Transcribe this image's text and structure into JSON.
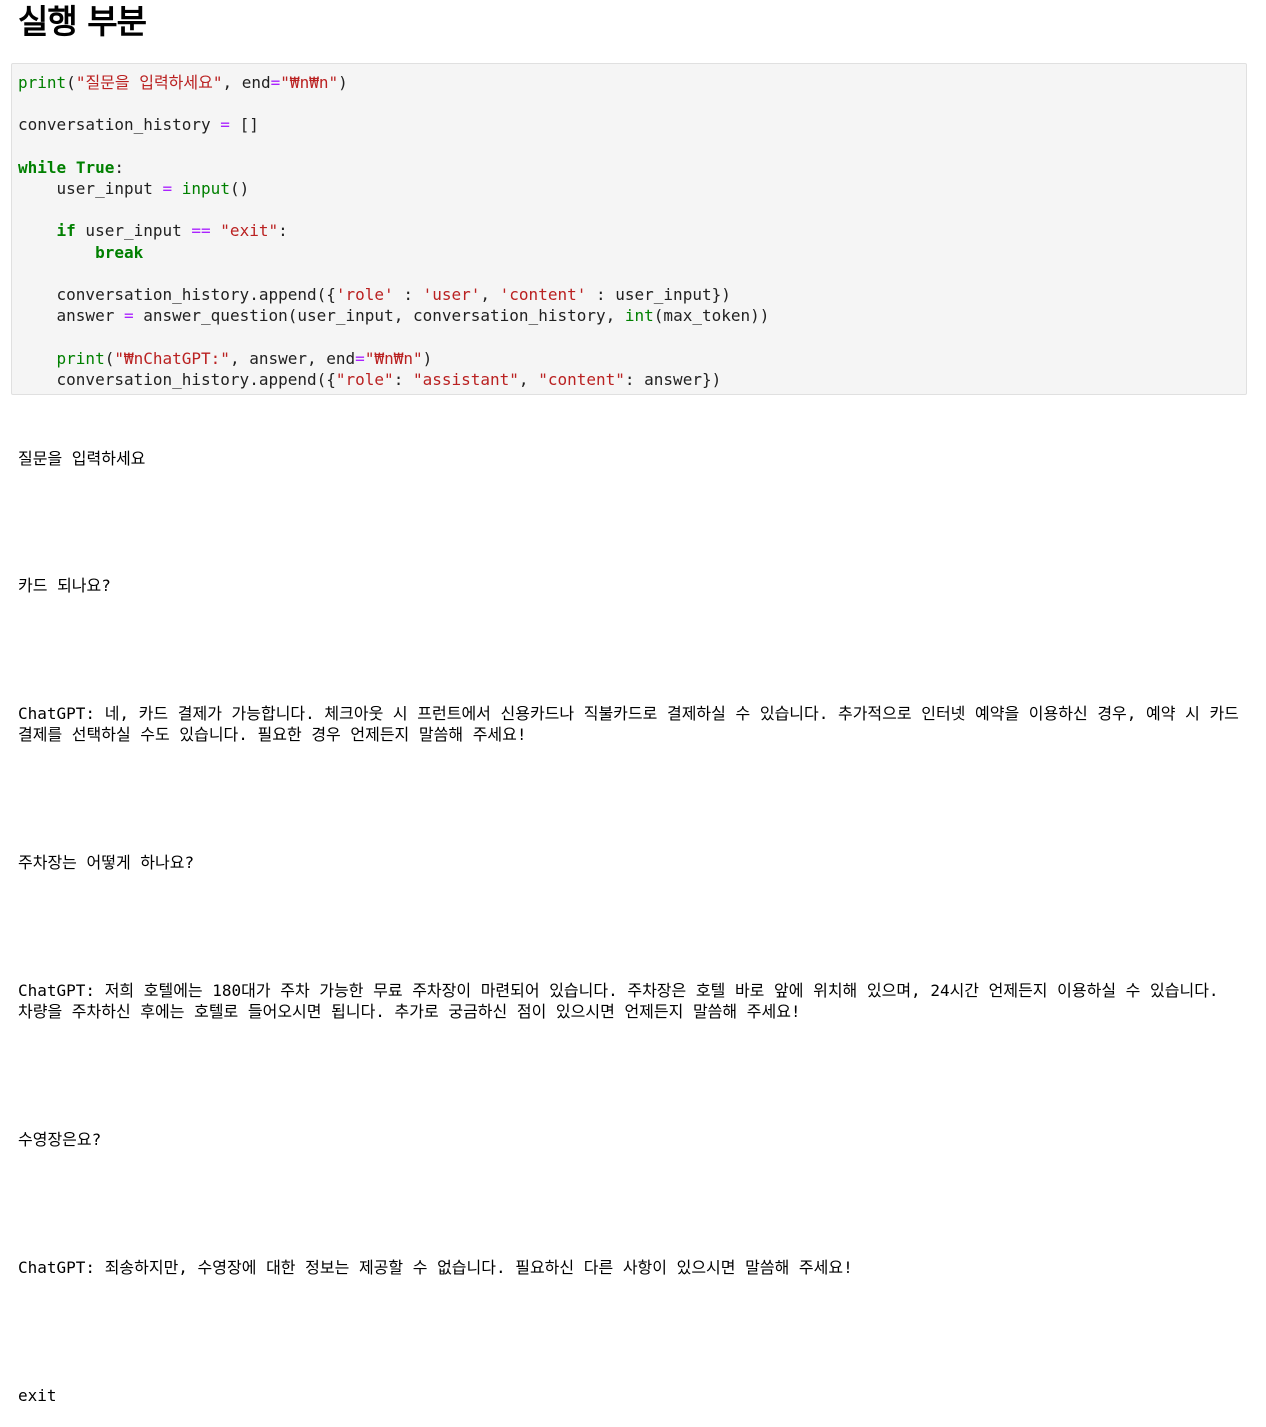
{
  "heading": "실행 부분",
  "code_lines": [
    [
      {
        "t": "bi",
        "v": "print"
      },
      {
        "t": "p",
        "v": "("
      },
      {
        "t": "st",
        "v": "\"질문을 입력하세요\""
      },
      {
        "t": "p",
        "v": ", end"
      },
      {
        "t": "op",
        "v": "="
      },
      {
        "t": "st",
        "v": "\"₩n₩n\""
      },
      {
        "t": "p",
        "v": ")"
      }
    ],
    [],
    [
      {
        "t": "p",
        "v": "conversation_history "
      },
      {
        "t": "op",
        "v": "="
      },
      {
        "t": "p",
        "v": " []"
      }
    ],
    [],
    [
      {
        "t": "kw",
        "v": "while"
      },
      {
        "t": "p",
        "v": " "
      },
      {
        "t": "kw",
        "v": "True"
      },
      {
        "t": "p",
        "v": ":"
      }
    ],
    [
      {
        "t": "p",
        "v": "    user_input "
      },
      {
        "t": "op",
        "v": "="
      },
      {
        "t": "p",
        "v": " "
      },
      {
        "t": "bi",
        "v": "input"
      },
      {
        "t": "p",
        "v": "()"
      }
    ],
    [],
    [
      {
        "t": "p",
        "v": "    "
      },
      {
        "t": "kw",
        "v": "if"
      },
      {
        "t": "p",
        "v": " user_input "
      },
      {
        "t": "op",
        "v": "=="
      },
      {
        "t": "p",
        "v": " "
      },
      {
        "t": "st",
        "v": "\"exit\""
      },
      {
        "t": "p",
        "v": ":"
      }
    ],
    [
      {
        "t": "p",
        "v": "        "
      },
      {
        "t": "kw",
        "v": "break"
      }
    ],
    [],
    [
      {
        "t": "p",
        "v": "    conversation_history.append({"
      },
      {
        "t": "st",
        "v": "'role'"
      },
      {
        "t": "p",
        "v": " : "
      },
      {
        "t": "st",
        "v": "'user'"
      },
      {
        "t": "p",
        "v": ", "
      },
      {
        "t": "st",
        "v": "'content'"
      },
      {
        "t": "p",
        "v": " : user_input})"
      }
    ],
    [
      {
        "t": "p",
        "v": "    answer "
      },
      {
        "t": "op",
        "v": "="
      },
      {
        "t": "p",
        "v": " answer_question(user_input, conversation_history, "
      },
      {
        "t": "bi",
        "v": "int"
      },
      {
        "t": "p",
        "v": "(max_token))"
      }
    ],
    [],
    [
      {
        "t": "p",
        "v": "    "
      },
      {
        "t": "bi",
        "v": "print"
      },
      {
        "t": "p",
        "v": "("
      },
      {
        "t": "st",
        "v": "\"₩nChatGPT:\""
      },
      {
        "t": "p",
        "v": ", answer, end"
      },
      {
        "t": "op",
        "v": "="
      },
      {
        "t": "st",
        "v": "\"₩n₩n\""
      },
      {
        "t": "p",
        "v": ")"
      }
    ],
    [
      {
        "t": "p",
        "v": "    conversation_history.append({"
      },
      {
        "t": "st",
        "v": "\"role\""
      },
      {
        "t": "p",
        "v": ": "
      },
      {
        "t": "st",
        "v": "\"assistant\""
      },
      {
        "t": "p",
        "v": ", "
      },
      {
        "t": "st",
        "v": "\"content\""
      },
      {
        "t": "p",
        "v": ": answer})"
      }
    ]
  ],
  "output": {
    "prompt": "질문을 입력하세요",
    "turns": [
      {
        "user": "카드 되나요?",
        "assistant": "ChatGPT: 네, 카드 결제가 가능합니다. 체크아웃 시 프런트에서 신용카드나 직불카드로 결제하실 수 있습니다. 추가적으로 인터넷 예약을 이용하신 경우, 예약 시 카드 결제를 선택하실 수도 있습니다. 필요한 경우 언제든지 말씀해 주세요!"
      },
      {
        "user": "주차장는 어떻게 하나요?",
        "assistant": "ChatGPT: 저희 호텔에는 180대가 주차 가능한 무료 주차장이 마련되어 있습니다. 주차장은 호텔 바로 앞에 위치해 있으며, 24시간 언제든지 이용하실 수 있습니다. 차량을 주차하신 후에는 호텔로 들어오시면 됩니다. 추가로 궁금하신 점이 있으시면 언제든지 말씀해 주세요!"
      },
      {
        "user": "수영장은요?",
        "assistant": "ChatGPT: 죄송하지만, 수영장에 대한 정보는 제공할 수 없습니다. 필요하신 다른 사항이 있으시면 말씀해 주세요!"
      }
    ],
    "exit_input": "exit"
  }
}
